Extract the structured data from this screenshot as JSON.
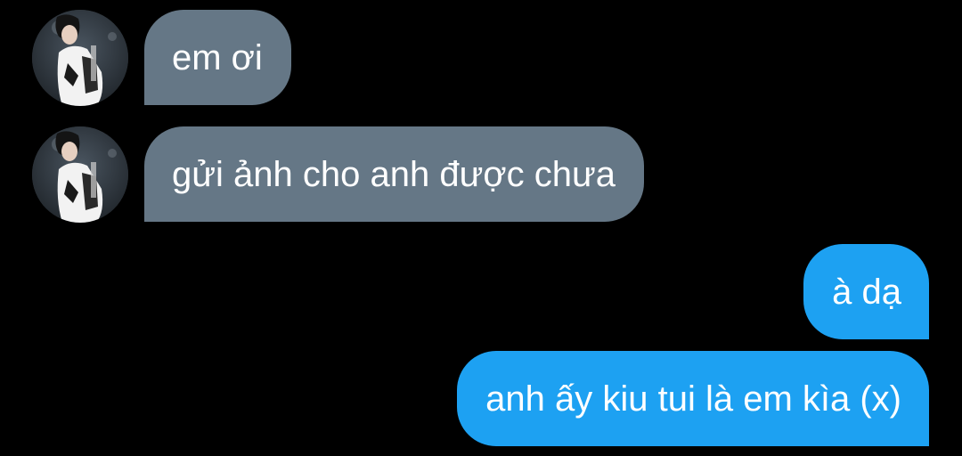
{
  "colors": {
    "background": "#000000",
    "incoming_bubble": "#657786",
    "outgoing_bubble": "#1da1f2",
    "text": "#ffffff"
  },
  "conversation": {
    "messages": [
      {
        "direction": "incoming",
        "text": "em ơi",
        "avatar": "profile-photo-icon"
      },
      {
        "direction": "incoming",
        "text": "gửi ảnh cho anh được chưa",
        "avatar": "profile-photo-icon"
      },
      {
        "direction": "outgoing",
        "text": "à dạ"
      },
      {
        "direction": "outgoing",
        "text": "anh ấy kiu tui là em kìa (x)"
      }
    ]
  }
}
